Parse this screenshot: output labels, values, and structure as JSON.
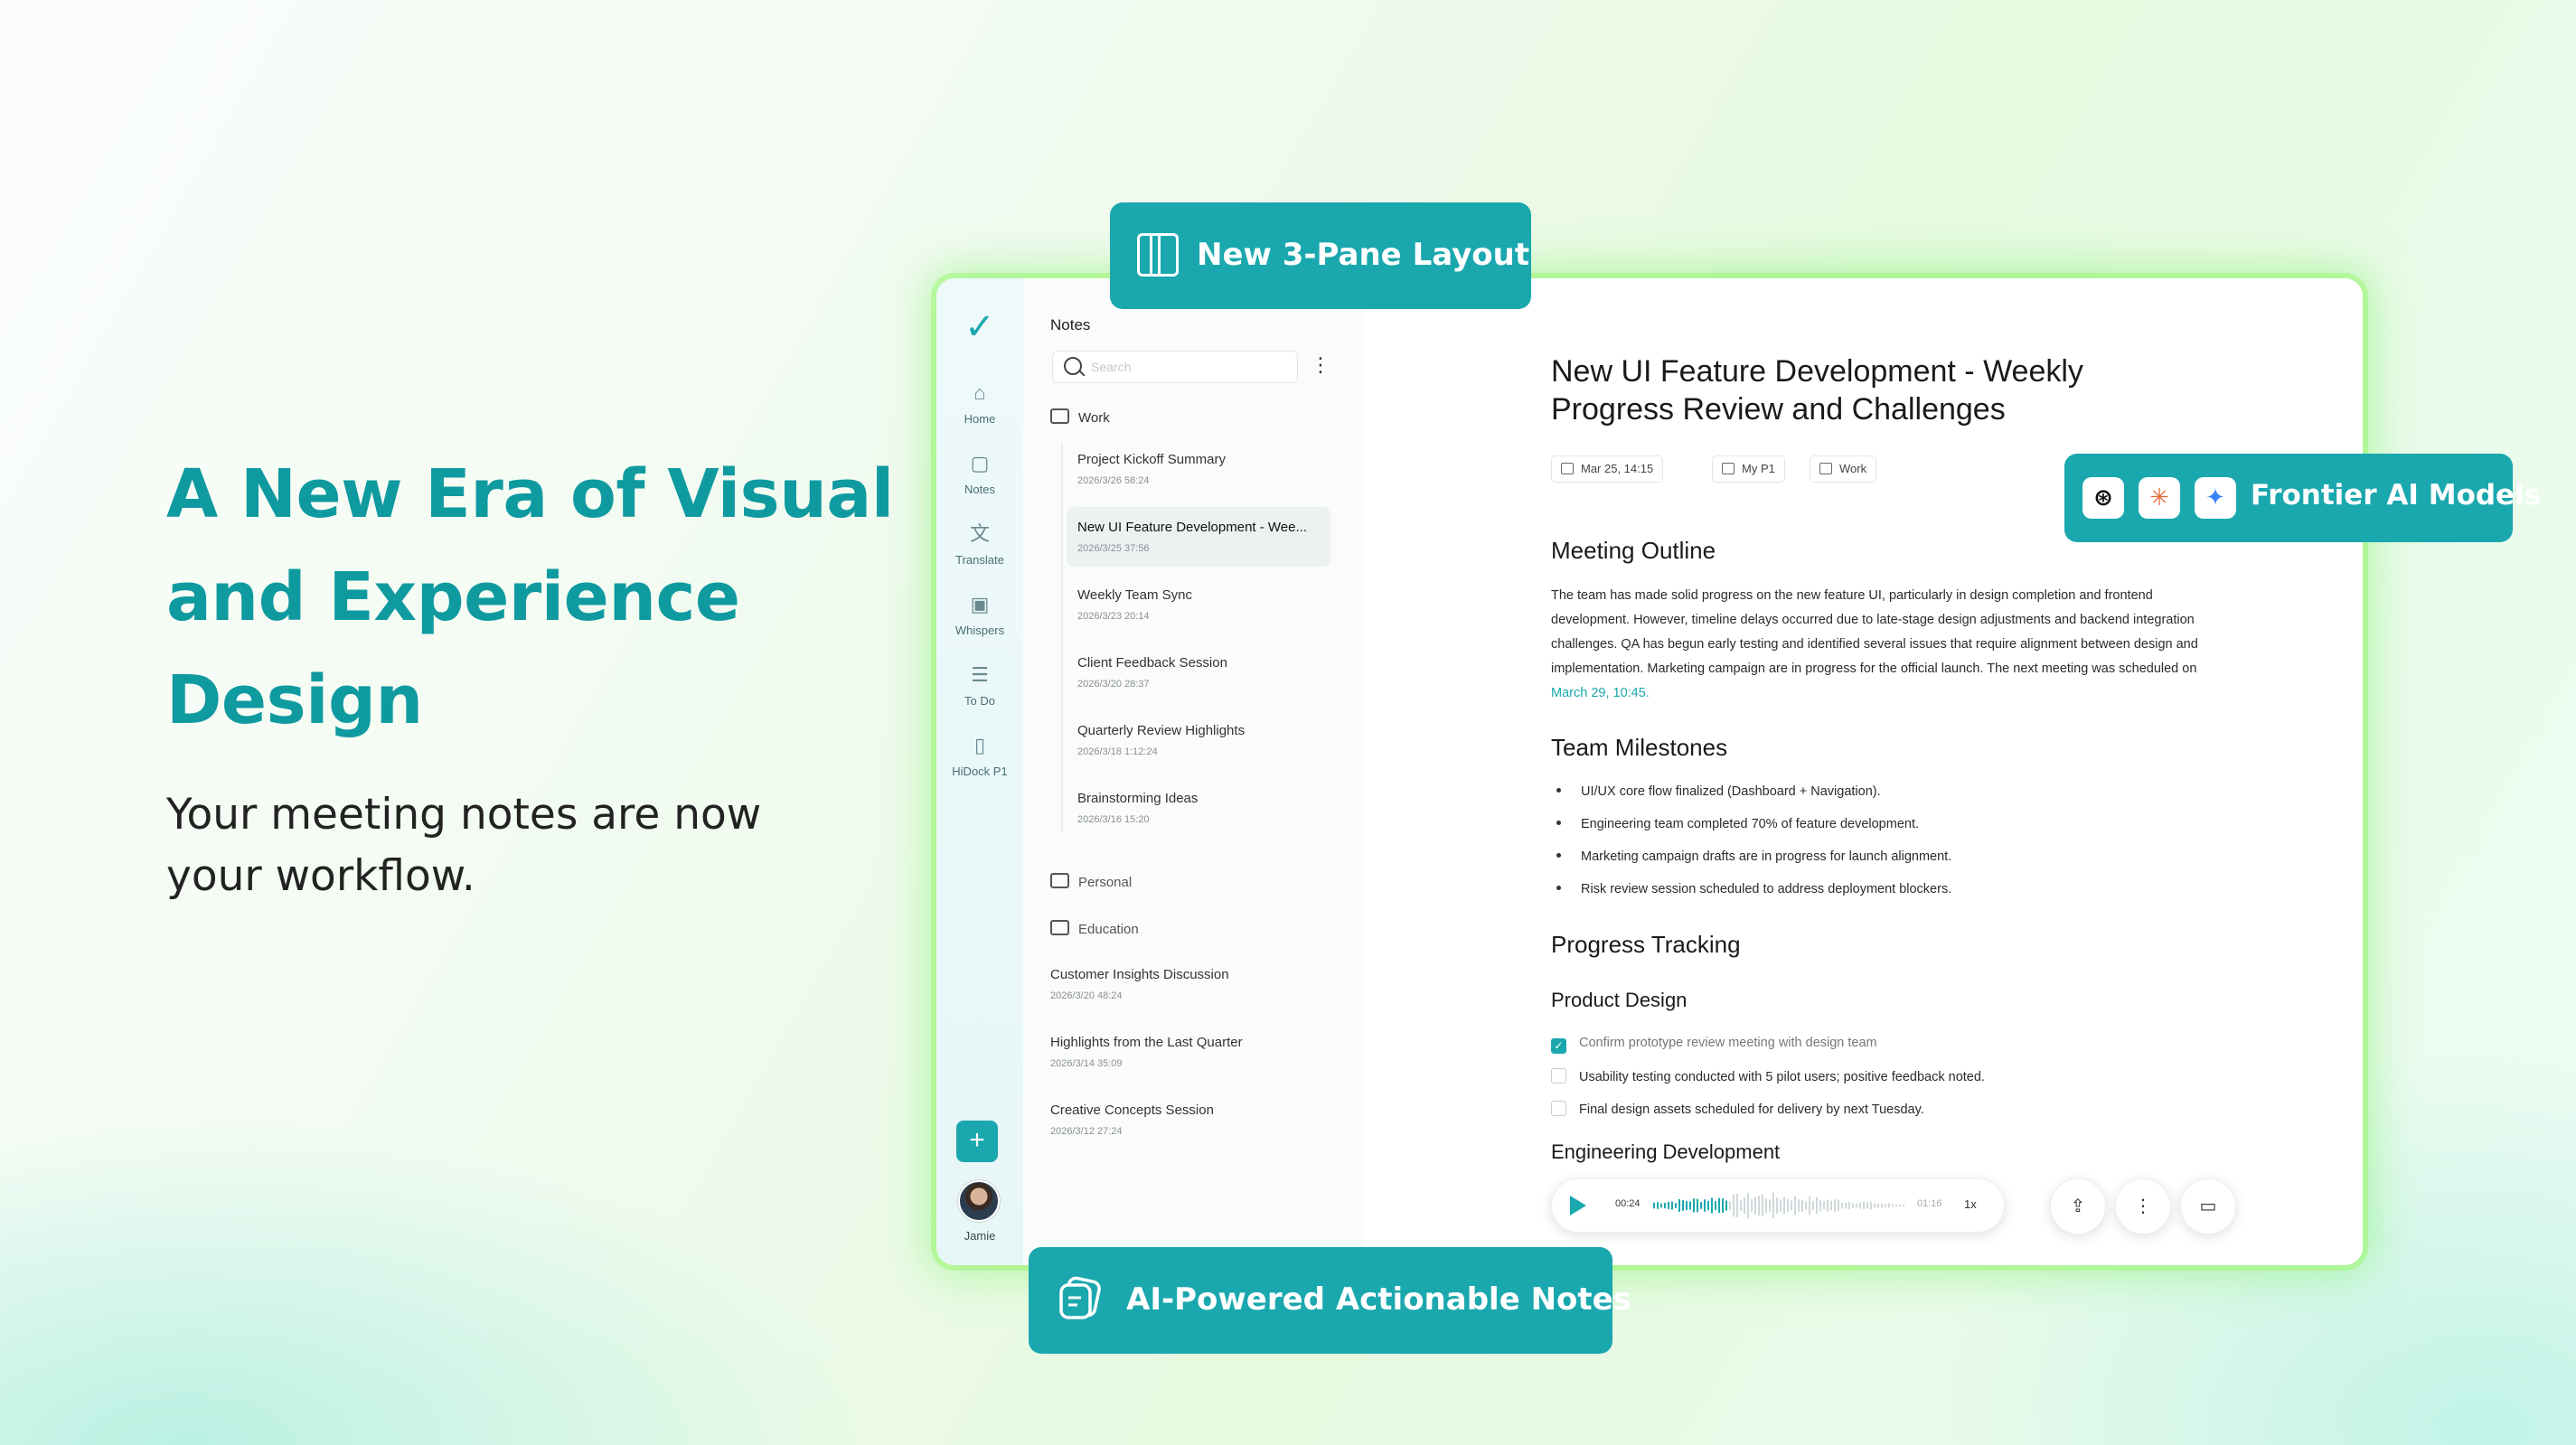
{
  "hero": {
    "title": "A New Era of Visual and Experience Design",
    "subtitle": "Your meeting notes are now your workflow."
  },
  "callouts": {
    "layout": "New 3-Pane Layout",
    "models": "Frontier AI Models",
    "notes": "AI-Powered Actionable Notes"
  },
  "rail": {
    "items": [
      {
        "label": "Home",
        "icon": "home-icon"
      },
      {
        "label": "Notes",
        "icon": "notes-icon"
      },
      {
        "label": "Translate",
        "icon": "translate-icon"
      },
      {
        "label": "Whispers",
        "icon": "whispers-icon"
      },
      {
        "label": "To Do",
        "icon": "todo-icon"
      },
      {
        "label": "HiDock P1",
        "icon": "device-icon"
      }
    ],
    "user": "Jamie"
  },
  "list": {
    "title": "Notes",
    "search_placeholder": "Search",
    "folders": {
      "work": "Work",
      "personal": "Personal",
      "education": "Education"
    },
    "work_notes": [
      {
        "title": "Project Kickoff Summary",
        "date": "2026/3/26  58:24"
      },
      {
        "title": "New UI Feature Development - Wee...",
        "date": "2026/3/25  37:56"
      },
      {
        "title": "Weekly Team Sync",
        "date": "2026/3/23  20:14"
      },
      {
        "title": "Client Feedback Session",
        "date": "2026/3/20  28:37"
      },
      {
        "title": "Quarterly Review Highlights",
        "date": "2026/3/18  1:12:24"
      },
      {
        "title": "Brainstorming Ideas",
        "date": "2026/3/16  15:20"
      }
    ],
    "other_notes": [
      {
        "title": "Customer Insights Discussion",
        "date": "2026/3/20  48:24"
      },
      {
        "title": "Highlights from the Last Quarter",
        "date": "2026/3/14  35:09"
      },
      {
        "title": "Creative Concepts Session",
        "date": "2026/3/12  27:24"
      }
    ]
  },
  "doc": {
    "title": "New UI Feature Development - Weekly Progress Review and Challenges",
    "meta": {
      "date": "Mar 25, 14:15",
      "device": "My P1",
      "folder": "Work"
    },
    "outline_heading": "Meeting Outline",
    "outline_text": "The team has made solid progress on the new feature UI, particularly in design completion and frontend development. However, timeline delays occurred due to late-stage design adjustments and backend integration challenges. QA has begun early testing and identified several issues that require alignment between design and implementation. Marketing campaign are in progress for the official launch. The next meeting was scheduled on ",
    "outline_link": "March 29, 10:45.",
    "milestones_heading": "Team Milestones",
    "milestones": [
      "UI/UX core flow finalized (Dashboard + Navigation).",
      "Engineering team completed 70% of feature development.",
      "Marketing campaign drafts are in progress for launch alignment.",
      "Risk review session scheduled to address deployment blockers."
    ],
    "tracking_heading": "Progress Tracking",
    "product_heading": "Product Design",
    "tasks": [
      {
        "text": "Confirm prototype review meeting with design team",
        "done": true
      },
      {
        "text": "Usability testing conducted with 5 pilot users; positive feedback noted.",
        "done": false
      },
      {
        "text": "Final design assets scheduled for delivery by next Tuesday.",
        "done": false
      }
    ],
    "engineering_heading": "Engineering Development"
  },
  "player": {
    "current": "00:24",
    "total": "01:16",
    "speed": "1x",
    "progress": 0.3
  },
  "colors": {
    "accent": "#1aa8ae",
    "hero": "#0f9aa0"
  }
}
